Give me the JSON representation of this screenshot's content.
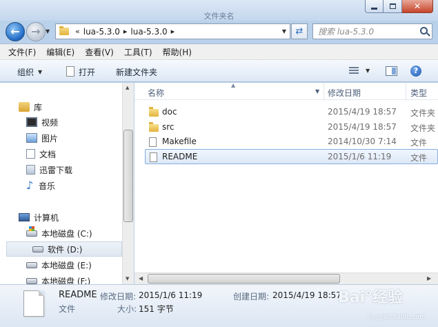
{
  "window": {
    "title": "文件夹名",
    "controls": {
      "minimize": "–",
      "maximize": "□",
      "close": "✕"
    }
  },
  "navigation": {
    "breadcrumb_prefix": "«",
    "breadcrumbs": [
      "lua-5.3.0",
      "lua-5.3.0"
    ],
    "search_placeholder": "搜索 lua-5.3.0"
  },
  "menubar": {
    "items": [
      "文件(F)",
      "编辑(E)",
      "查看(V)",
      "工具(T)",
      "帮助(H)"
    ]
  },
  "toolbar": {
    "organize": "组织",
    "open": "打开",
    "new_folder": "新建文件夹",
    "help": "?"
  },
  "sidebar": {
    "items": [
      {
        "label": "库",
        "icon": "library-icon"
      },
      {
        "label": "视频",
        "icon": "video-icon"
      },
      {
        "label": "图片",
        "icon": "pictures-icon"
      },
      {
        "label": "文档",
        "icon": "documents-icon"
      },
      {
        "label": "迅雷下载",
        "icon": "download-icon"
      },
      {
        "label": "音乐",
        "icon": "music-icon"
      },
      {
        "label": "计算机",
        "icon": "computer-icon"
      },
      {
        "label": "本地磁盘 (C:)",
        "icon": "system-drive-icon"
      },
      {
        "label": "软件 (D:)",
        "icon": "drive-icon",
        "selected": true
      },
      {
        "label": "本地磁盘 (E:)",
        "icon": "drive-icon"
      },
      {
        "label": "本地磁盘 (F:)",
        "icon": "drive-icon"
      }
    ]
  },
  "file_list": {
    "columns": [
      "名称",
      "修改日期",
      "类型"
    ],
    "rows": [
      {
        "name": "doc",
        "modified": "2015/4/19 18:57",
        "type": "文件夹",
        "kind": "folder"
      },
      {
        "name": "src",
        "modified": "2015/4/19 18:57",
        "type": "文件夹",
        "kind": "folder"
      },
      {
        "name": "Makefile",
        "modified": "2014/10/30 7:14",
        "type": "文件",
        "kind": "file"
      },
      {
        "name": "README",
        "modified": "2015/1/6 11:19",
        "type": "文件",
        "kind": "file",
        "selected": true
      }
    ]
  },
  "details": {
    "name": "README",
    "type": "文件",
    "modified_label": "修改日期:",
    "modified_value": "2015/1/6 11:19",
    "created_label": "创建日期:",
    "created_value": "2015/4/19 18:57",
    "size_label": "大小:",
    "size_value": "151 字节"
  },
  "watermark": {
    "text": "Bai°经验",
    "sub": "jingyan.baidu.com"
  },
  "colors": {
    "selection_border": "#84acdd",
    "frame": "#b9d1ea"
  }
}
